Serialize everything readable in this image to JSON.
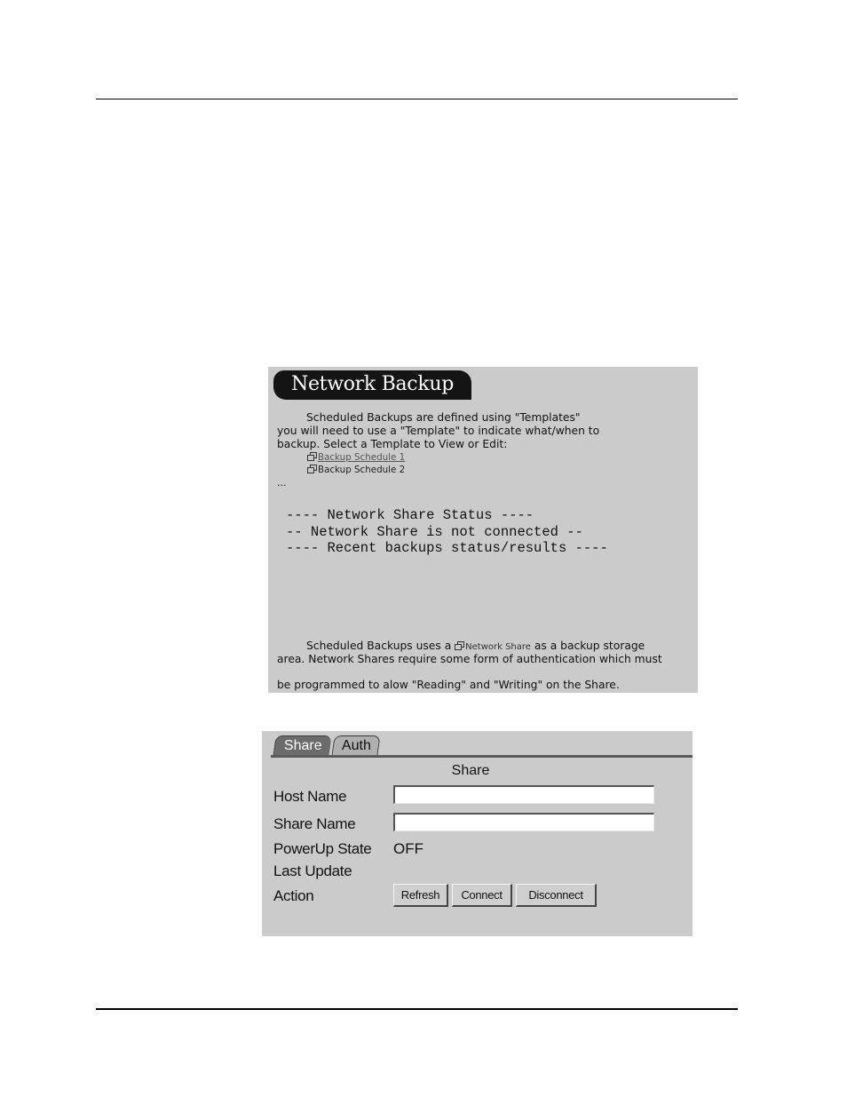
{
  "network_backup_panel": {
    "title": "Network Backup",
    "intro_line1": "Scheduled Backups are defined using \"Templates\"",
    "intro_line2": "you will need to use a \"Template\" to indicate what/when to",
    "intro_line3": "backup. Select a Template to View or Edit:",
    "templates": [
      {
        "label": "Backup Schedule 1",
        "icon": "window-icon"
      },
      {
        "label": "Backup Schedule 2",
        "icon": "window-icon"
      }
    ],
    "ellipsis": "...",
    "status_lines": [
      "---- Network Share Status ----",
      "-- Network Share is not connected --",
      "---- Recent backups status/results ----"
    ],
    "footer_part1": "Scheduled Backups uses a",
    "footer_link": "Network Share",
    "footer_part2": "as a backup storage",
    "footer_line2": "area. Network Shares require some form of authentication which must",
    "footer_line3": "be programmed to alow \"Reading\" and \"Writing\" on the Share."
  },
  "share_panel": {
    "tabs": [
      {
        "label": "Share",
        "active": true
      },
      {
        "label": "Auth",
        "active": false
      }
    ],
    "section_title": "Share",
    "fields": {
      "host_name": {
        "label": "Host Name",
        "value": ""
      },
      "share_name": {
        "label": "Share Name",
        "value": ""
      },
      "powerup_state": {
        "label": "PowerUp State",
        "value": "OFF"
      },
      "last_update": {
        "label": "Last Update",
        "value": ""
      },
      "action": {
        "label": "Action"
      }
    },
    "buttons": {
      "refresh": "Refresh",
      "connect": "Connect",
      "disconnect": "Disconnect"
    }
  }
}
